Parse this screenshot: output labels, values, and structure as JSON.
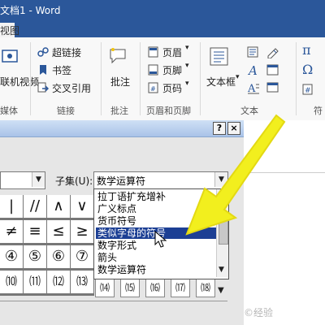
{
  "window": {
    "title": "文档1 - Word",
    "colors": {
      "titlebar": "#2b579a",
      "selection": "#1c3f94",
      "arrow": "#f2ef1e"
    }
  },
  "ribbon": {
    "tab_view": "视图",
    "items": {
      "online_video": "联机视频",
      "hyperlink": "超链接",
      "bookmark": "书签",
      "cross_ref": "交叉引用",
      "comment": "批注",
      "header": "页眉",
      "footer": "页脚",
      "page_number": "页码",
      "textbox": "文本框",
      "pi": "π",
      "omega": "Ω"
    },
    "groups": {
      "media": "媒体",
      "links": "链接",
      "comments": "批注",
      "header_footer": "页眉和页脚",
      "text": "文本",
      "symbols_partial": "符"
    }
  },
  "dialog": {
    "help": "?",
    "close": "×",
    "subset_label": "子集(U):",
    "subset_value": "数学运算符",
    "dropdown_arrow": "▼",
    "grid_rows": [
      [
        "|",
        "//",
        "∧",
        "∨"
      ],
      [
        "≠",
        "≡",
        "≤",
        "≥"
      ],
      [
        "④",
        "⑤",
        "⑥",
        "⑦"
      ],
      [
        "⑽",
        "⑾",
        "⑿",
        "⒀"
      ]
    ],
    "subset_options": [
      "拉丁语扩充增补",
      "广义标点",
      "货币符号",
      "类似字母的符号",
      "数字形式",
      "箭头",
      "数学运算符"
    ],
    "selected_option": "类似字母的符号",
    "bottom_cells": [
      "⒁",
      "⒂",
      "⒃",
      "⒄",
      "⒅"
    ]
  },
  "watermark": "©经验"
}
